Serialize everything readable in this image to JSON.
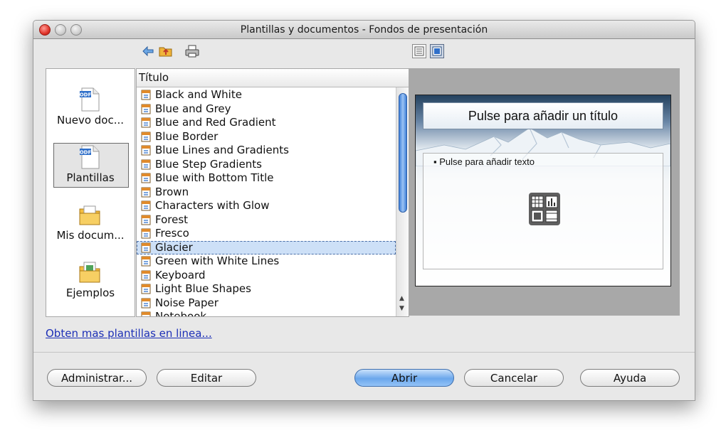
{
  "window": {
    "title": "Plantillas y documentos - Fondos de presentación"
  },
  "toolbar": {
    "icons": [
      "back-arrow-icon",
      "open-folder-icon",
      "print-icon"
    ],
    "view_buttons": [
      "detail-view-icon",
      "preview-view-icon"
    ]
  },
  "categories": [
    {
      "label": "Nuevo doc...",
      "icon": "odf-document-icon"
    },
    {
      "label": "Plantillas",
      "icon": "odf-document-icon",
      "selected": true
    },
    {
      "label": "Mis docum...",
      "icon": "folder-icon"
    },
    {
      "label": "Ejemplos",
      "icon": "folder-icon"
    }
  ],
  "list": {
    "header": "Título",
    "items": [
      "Black and White",
      "Blue and Grey",
      "Blue and Red Gradient",
      "Blue Border",
      "Blue Lines and Gradients",
      "Blue Step Gradients",
      "Blue with Bottom Title",
      "Brown",
      "Characters with Glow",
      "Forest",
      "Fresco",
      "Glacier",
      "Green with White Lines",
      "Keyboard",
      "Light Blue Shapes",
      "Noise Paper",
      "Notebook"
    ],
    "selected": "Glacier"
  },
  "preview": {
    "title_placeholder": "Pulse para añadir un título",
    "body_placeholder": "Pulse para añadir texto"
  },
  "link_text": "Obten mas plantillas en linea...",
  "buttons": {
    "manage": "Administrar...",
    "edit": "Editar",
    "open": "Abrir",
    "cancel": "Cancelar",
    "help": "Ayuda"
  }
}
